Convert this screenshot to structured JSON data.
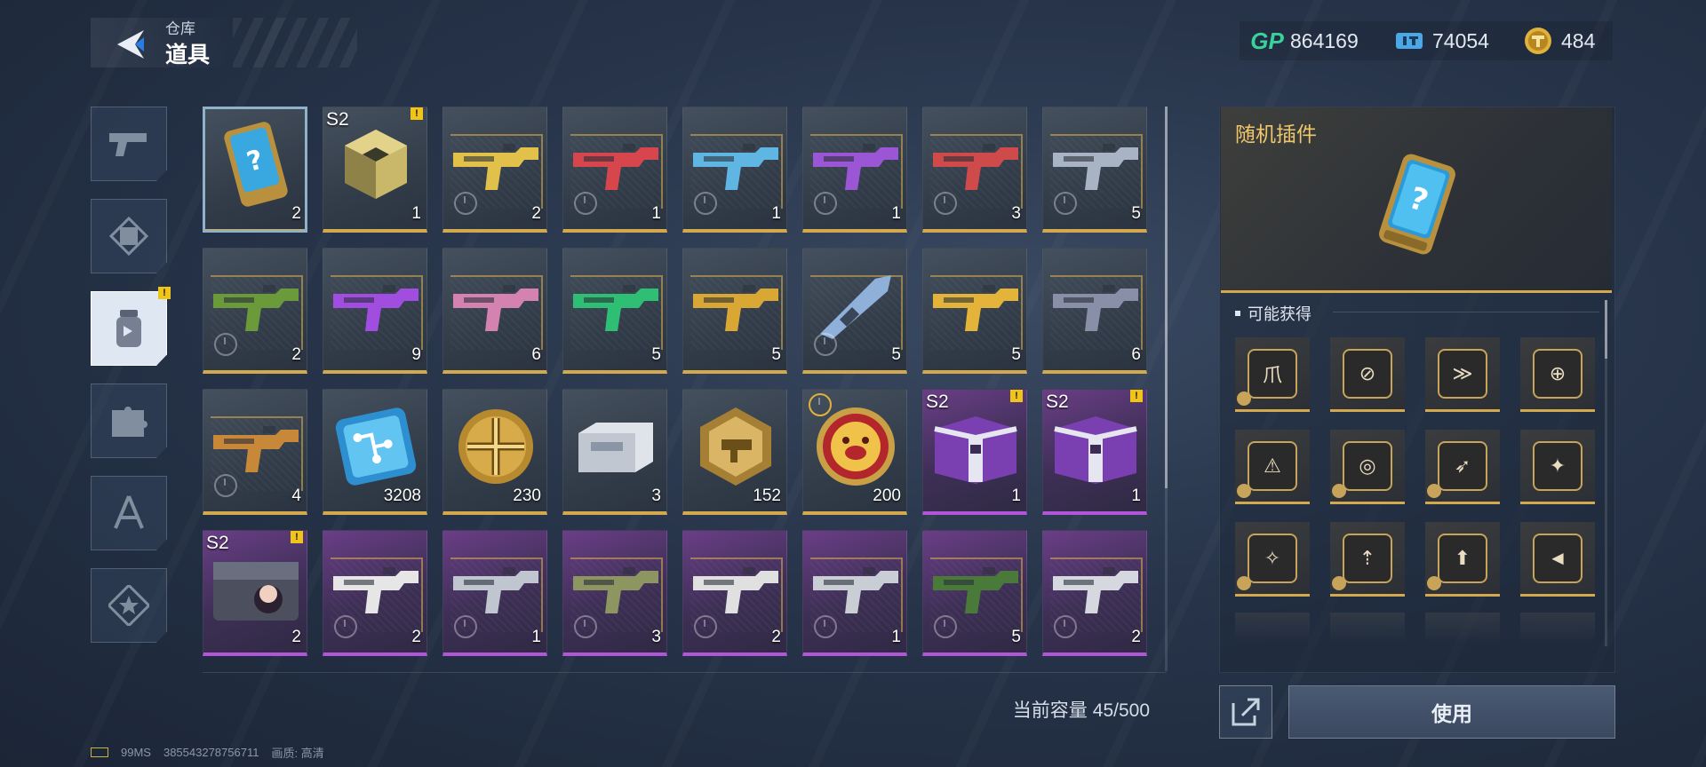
{
  "header": {
    "breadcrumb": "仓库",
    "title": "道具"
  },
  "currencies": [
    {
      "icon": "gp-icon",
      "code": "GP",
      "value": "864169",
      "color": "#38d39a"
    },
    {
      "icon": "ticket-icon",
      "value": "74054",
      "color": "#4aa8e6"
    },
    {
      "icon": "t-coin-icon",
      "value": "484",
      "color": "#e0b23c"
    }
  ],
  "categories": [
    {
      "name": "weapons",
      "icon": "pistol-icon",
      "active": false
    },
    {
      "name": "outfits",
      "icon": "frame-icon",
      "active": false
    },
    {
      "name": "items",
      "icon": "bottle-icon",
      "active": true,
      "badge": "!"
    },
    {
      "name": "mods",
      "icon": "puzzle-icon",
      "active": false
    },
    {
      "name": "blueprints",
      "icon": "compass-icon",
      "active": false
    },
    {
      "name": "specials",
      "icon": "star-icon",
      "active": false
    }
  ],
  "inventory": [
    {
      "kind": "chip",
      "qty": "2",
      "rarity": "gold",
      "selected": true
    },
    {
      "kind": "cube",
      "qty": "1",
      "rarity": "gold",
      "season": "S2",
      "badge": "!"
    },
    {
      "kind": "gun",
      "qty": "2",
      "rarity": "gold",
      "tint": "#e2c14a",
      "timer": true
    },
    {
      "kind": "gun",
      "qty": "1",
      "rarity": "gold",
      "tint": "#d8464d",
      "timer": true
    },
    {
      "kind": "gun",
      "qty": "1",
      "rarity": "gold",
      "tint": "#5fb6e3",
      "timer": true
    },
    {
      "kind": "gun",
      "qty": "1",
      "rarity": "gold",
      "tint": "#9b56d6",
      "timer": true
    },
    {
      "kind": "gun",
      "qty": "3",
      "rarity": "gold",
      "tint": "#cf4a4a",
      "timer": true
    },
    {
      "kind": "gun",
      "qty": "5",
      "rarity": "gold",
      "tint": "#a8b4c4",
      "timer": true
    },
    {
      "kind": "gun",
      "qty": "2",
      "rarity": "gold",
      "tint": "#6a9a3a",
      "timer": true
    },
    {
      "kind": "gun",
      "qty": "9",
      "rarity": "gold",
      "tint": "#a04de0",
      "timer": false
    },
    {
      "kind": "gun",
      "qty": "6",
      "rarity": "gold",
      "tint": "#d483b0",
      "timer": false
    },
    {
      "kind": "gun",
      "qty": "5",
      "rarity": "gold",
      "tint": "#2fbf74",
      "timer": false
    },
    {
      "kind": "gun",
      "qty": "5",
      "rarity": "gold",
      "tint": "#d9a733",
      "timer": false
    },
    {
      "kind": "blade",
      "qty": "5",
      "rarity": "gold",
      "tint": "#8fb0d8",
      "timer": true
    },
    {
      "kind": "gun",
      "qty": "5",
      "rarity": "gold",
      "tint": "#e4b43a",
      "timer": false
    },
    {
      "kind": "gun",
      "qty": "6",
      "rarity": "gold",
      "tint": "#8a8fa8",
      "timer": false
    },
    {
      "kind": "gun",
      "qty": "4",
      "rarity": "gold",
      "tint": "#c8883a",
      "timer": true
    },
    {
      "kind": "circuit",
      "qty": "3208",
      "rarity": "gold"
    },
    {
      "kind": "medal",
      "qty": "230",
      "rarity": "gold"
    },
    {
      "kind": "box",
      "qty": "3",
      "rarity": "gold"
    },
    {
      "kind": "hexbadge",
      "qty": "152",
      "rarity": "gold"
    },
    {
      "kind": "pig",
      "qty": "200",
      "rarity": "gold",
      "topclock": true
    },
    {
      "kind": "crate",
      "qty": "1",
      "rarity": "purple",
      "season": "S2",
      "badge": "!"
    },
    {
      "kind": "crate",
      "qty": "1",
      "rarity": "purple",
      "season": "S2",
      "badge": "!"
    },
    {
      "kind": "chest",
      "qty": "2",
      "rarity": "purple",
      "season": "S2",
      "badge": "!"
    },
    {
      "kind": "gun",
      "qty": "2",
      "rarity": "purple",
      "tint": "#e6e6e6",
      "timer": true
    },
    {
      "kind": "gun",
      "qty": "1",
      "rarity": "purple",
      "tint": "#bfc6cf",
      "timer": true
    },
    {
      "kind": "gun",
      "qty": "3",
      "rarity": "purple",
      "tint": "#8d9560",
      "timer": true
    },
    {
      "kind": "gun",
      "qty": "2",
      "rarity": "purple",
      "tint": "#e0e0e0",
      "timer": true
    },
    {
      "kind": "gun",
      "qty": "1",
      "rarity": "purple",
      "tint": "#c9cdd4",
      "timer": true
    },
    {
      "kind": "gun",
      "qty": "5",
      "rarity": "purple",
      "tint": "#4a7a3a",
      "timer": true
    },
    {
      "kind": "gun",
      "qty": "2",
      "rarity": "purple",
      "tint": "#d5d8de",
      "timer": true
    }
  ],
  "capacity": {
    "label": "当前容量",
    "value": "45/500"
  },
  "detail": {
    "name": "随机插件",
    "possible_title": "可能获得",
    "plugins": [
      "爪",
      "⊘",
      "≫",
      "⊕",
      "⚠",
      "◎",
      "➶",
      "✦",
      "✧",
      "⇡",
      "⬆",
      "◄"
    ]
  },
  "actions": {
    "use": "使用"
  },
  "footer": {
    "ping": "99MS",
    "uid": "385543278756711",
    "quality_label": "画质:",
    "quality_value": "高清"
  }
}
